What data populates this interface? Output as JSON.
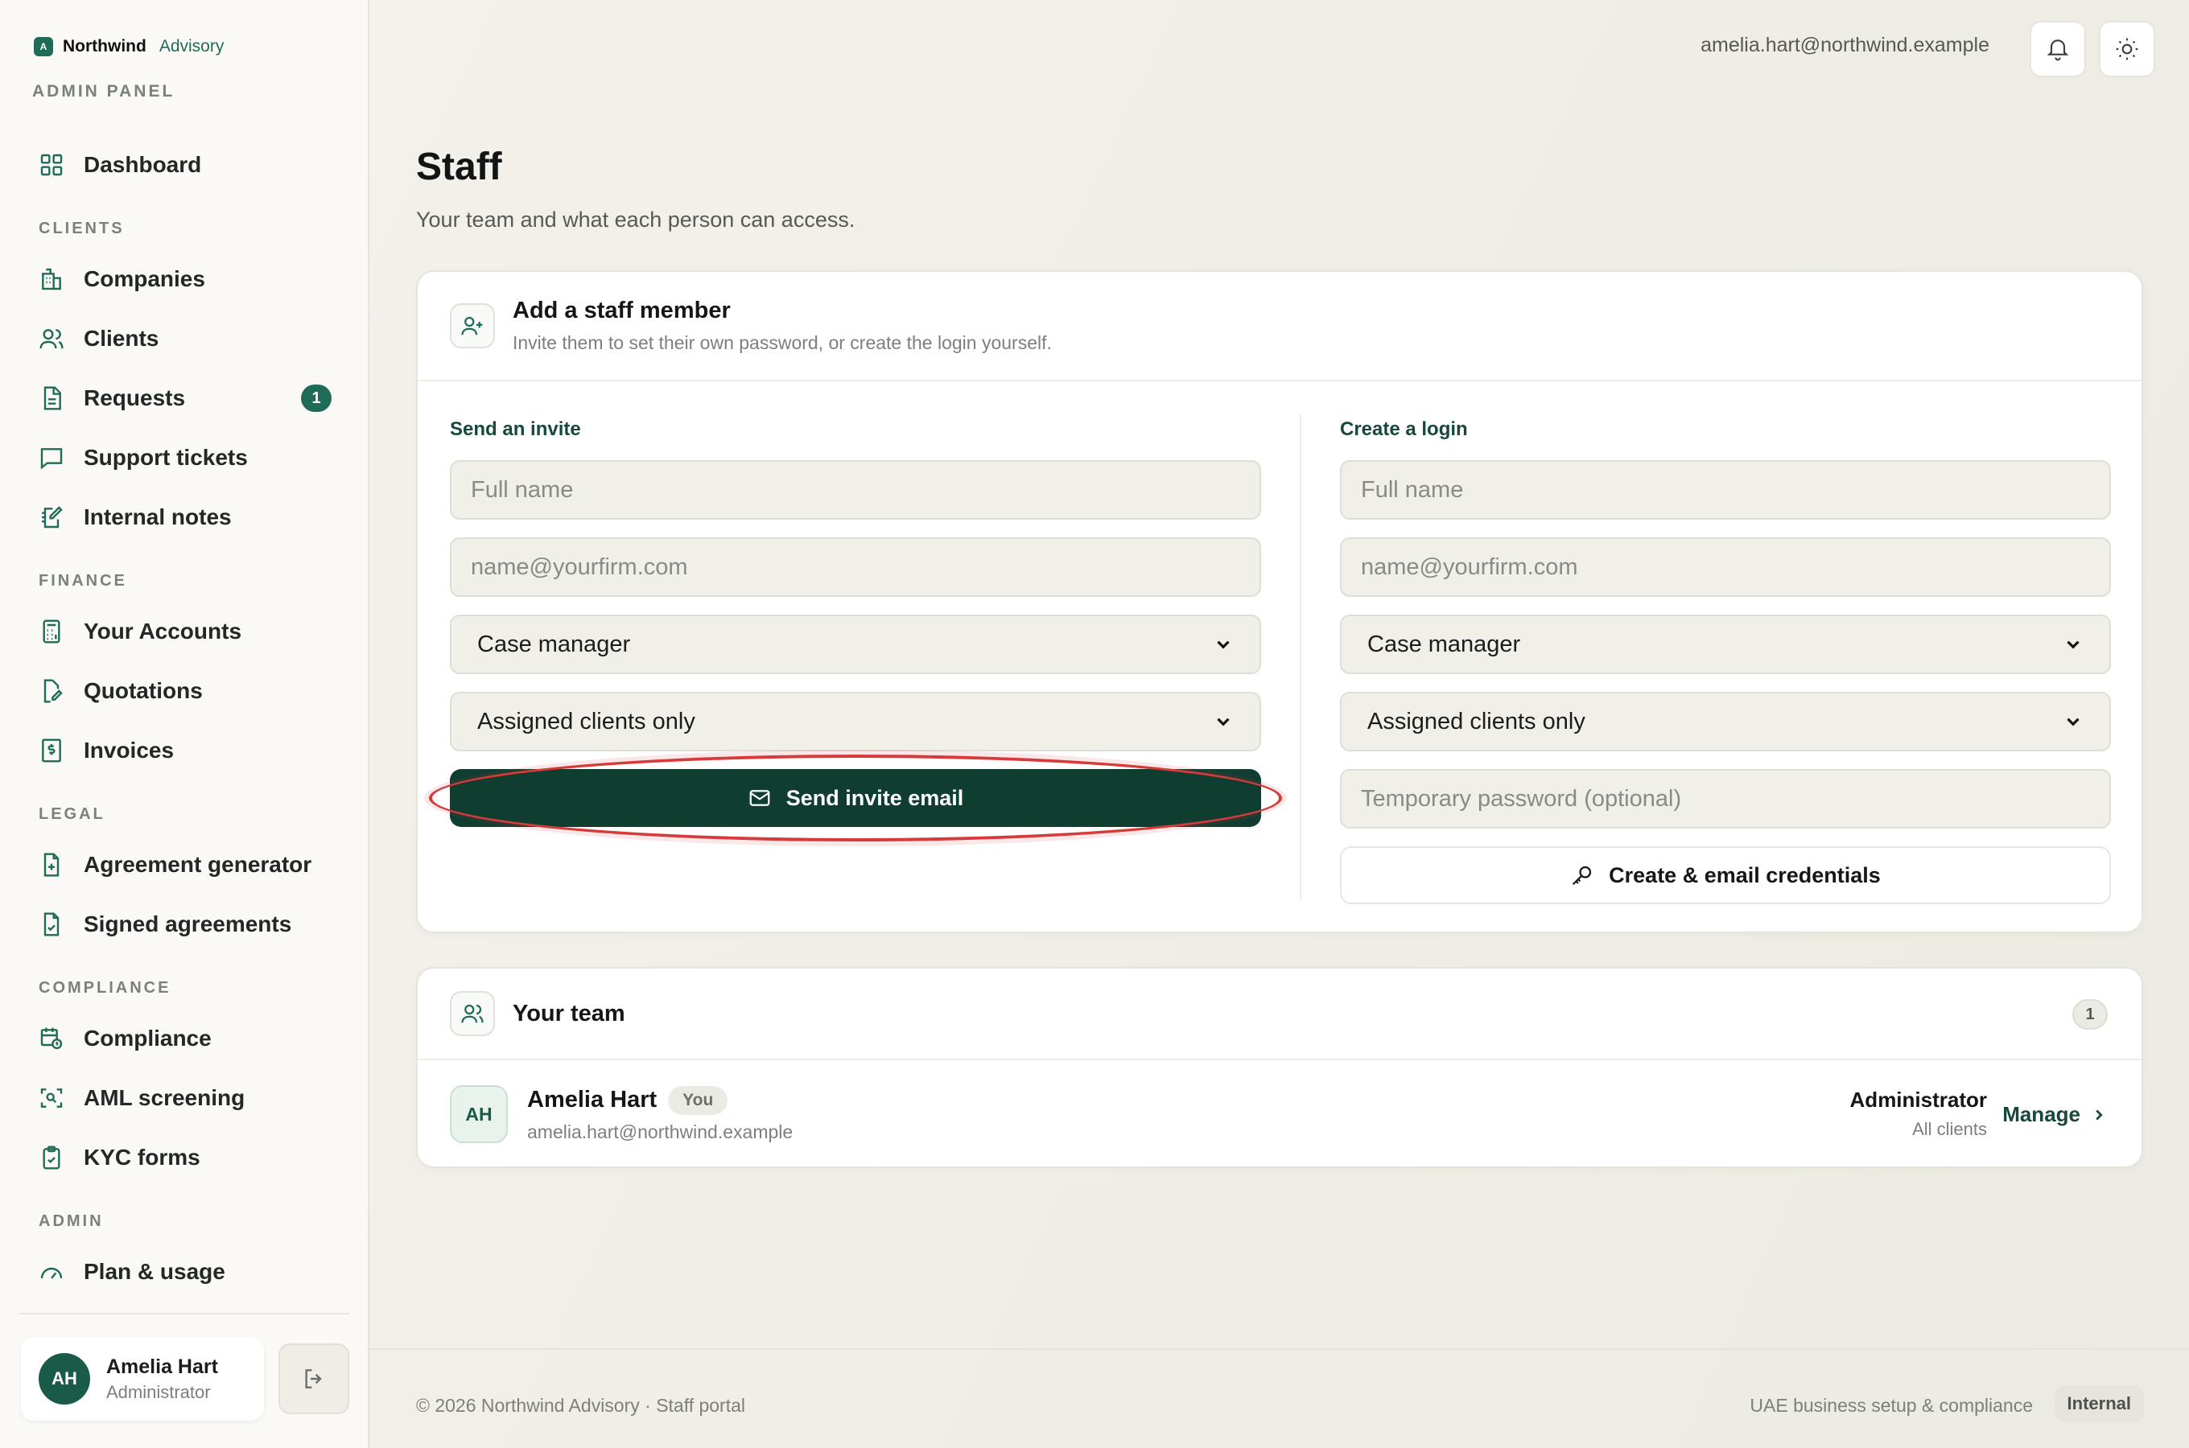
{
  "brand": {
    "name": "Northwind",
    "sub": "Advisory",
    "mark": "A",
    "panel_label": "ADMIN PANEL"
  },
  "sidebar": {
    "dashboard": "Dashboard",
    "sections": {
      "clients": "CLIENTS",
      "finance": "FINANCE",
      "legal": "LEGAL",
      "compliance": "COMPLIANCE",
      "admin": "ADMIN"
    },
    "items": {
      "companies": "Companies",
      "clients": "Clients",
      "requests": "Requests",
      "requests_badge": "1",
      "support_tickets": "Support tickets",
      "internal_notes": "Internal notes",
      "your_accounts": "Your Accounts",
      "quotations": "Quotations",
      "invoices": "Invoices",
      "agreement_generator": "Agreement generator",
      "signed_agreements": "Signed agreements",
      "compliance": "Compliance",
      "aml_screening": "AML screening",
      "kyc_forms": "KYC forms",
      "plan_usage": "Plan & usage"
    },
    "user": {
      "initials": "AH",
      "name": "Amelia Hart",
      "role": "Administrator"
    }
  },
  "topbar": {
    "email": "amelia.hart@northwind.example"
  },
  "page": {
    "title": "Staff",
    "subtitle": "Your team and what each person can access."
  },
  "add_card": {
    "title": "Add a staff member",
    "subtitle": "Invite them to set their own password, or create the login yourself.",
    "invite": {
      "title": "Send an invite",
      "name_placeholder": "Full name",
      "email_placeholder": "name@yourfirm.com",
      "role_value": "Case manager",
      "access_value": "Assigned clients only",
      "button": "Send invite email"
    },
    "login": {
      "title": "Create a login",
      "name_placeholder": "Full name",
      "email_placeholder": "name@yourfirm.com",
      "role_value": "Case manager",
      "access_value": "Assigned clients only",
      "password_placeholder": "Temporary password (optional)",
      "button": "Create & email credentials"
    }
  },
  "team_card": {
    "title": "Your team",
    "count": "1",
    "members": [
      {
        "initials": "AH",
        "name": "Amelia Hart",
        "tag": "You",
        "email": "amelia.hart@northwind.example",
        "role": "Administrator",
        "scope": "All clients",
        "action": "Manage"
      }
    ]
  },
  "footer": {
    "left": "© 2026 Northwind Advisory · Staff portal",
    "right": "UAE business setup & compliance",
    "tag": "Internal"
  },
  "colors": {
    "accent": "#1f6b57",
    "primary_button": "#0f3d30",
    "highlight": "#d63a3a"
  }
}
